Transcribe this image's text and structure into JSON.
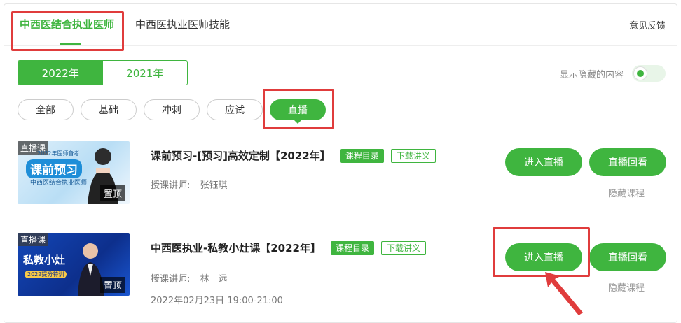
{
  "tabs": [
    {
      "label": "中西医结合执业医师",
      "active": true
    },
    {
      "label": "中西医执业医师技能",
      "active": false
    }
  ],
  "feedback_label": "意见反馈",
  "years": [
    {
      "label": "2022年",
      "active": true
    },
    {
      "label": "2021年",
      "active": false
    }
  ],
  "show_hidden": {
    "label": "显示隐藏的内容",
    "on": true
  },
  "filters": [
    "全部",
    "基础",
    "冲刺",
    "应试",
    "直播"
  ],
  "active_filter": "直播",
  "courses": [
    {
      "thumb_tag": "直播课",
      "thumb_pin": "置顶",
      "thumb_text": "课前预习",
      "thumb_sub": "中西医结合执业医师",
      "thumb_small": "2022年医师备考",
      "title": "课前预习-[预习]高效定制【2022年】",
      "badge_catalog": "课程目录",
      "badge_download": "下载讲义",
      "teacher_label": "授课讲师:",
      "teacher": "张钰琪",
      "datetime": "",
      "enter_label": "进入直播",
      "replay_label": "直播回看",
      "hide_label": "隐藏课程"
    },
    {
      "thumb_tag": "直播课",
      "thumb_pin": "置顶",
      "thumb_text": "私教小灶",
      "thumb_sub": "2022提分特训",
      "thumb_small": "",
      "title": "中西医执业-私教小灶课【2022年】",
      "badge_catalog": "课程目录",
      "badge_download": "下载讲义",
      "teacher_label": "授课讲师:",
      "teacher": "林　远",
      "datetime": "2022年02月23日 19:00-21:00",
      "enter_label": "进入直播",
      "replay_label": "直播回看",
      "hide_label": "隐藏课程"
    }
  ],
  "colors": {
    "accent": "#3fb53f",
    "highlight": "#e03c3c"
  }
}
